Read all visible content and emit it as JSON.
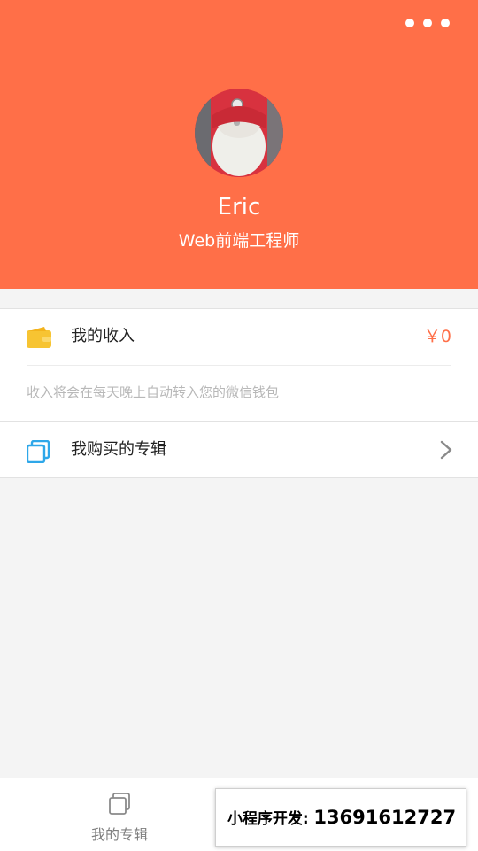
{
  "colors": {
    "accent": "#ff6f48",
    "background": "#f4f4f4",
    "wallet": "#f7c432",
    "album": "#2ea7e9",
    "muted": "#b8b8b8"
  },
  "header": {
    "more_icon": "more-dots-icon",
    "avatar_icon": "avatar-image",
    "name": "Eric",
    "title": "Web前端工程师"
  },
  "income": {
    "icon": "wallet-icon",
    "label": "我的收入",
    "amount": "￥0",
    "hint": "收入将会在每天晚上自动转入您的微信钱包"
  },
  "albums": {
    "icon": "album-stack-icon",
    "label": "我购买的专辑",
    "chevron": "chevron-right-icon"
  },
  "tabbar": {
    "tabs": [
      {
        "label": "我的专辑",
        "icon": "album-stack-icon"
      }
    ]
  },
  "promo": {
    "label": "小程序开发:",
    "phone": "13691612727"
  }
}
